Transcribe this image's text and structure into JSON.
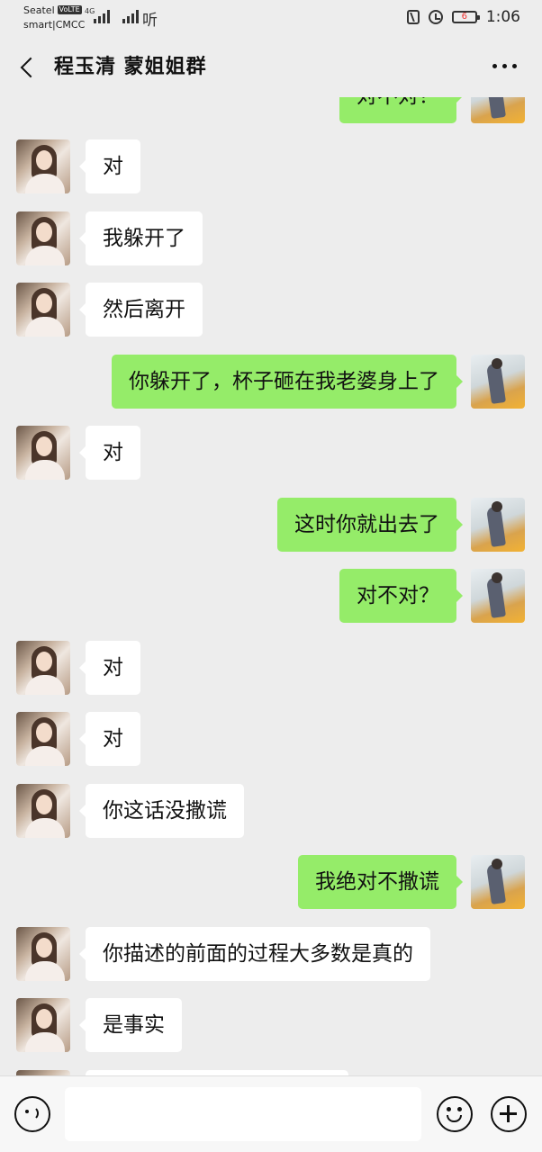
{
  "status_bar": {
    "carrier_1": "Seatel",
    "volte": "VoLTE",
    "carrier_2": "smart|CMCC",
    "network": "4G",
    "speed_indicator": "听",
    "battery_level": "6",
    "time": "1:06"
  },
  "nav": {
    "title": "程玉清 蒙姐姐群"
  },
  "messages": [
    {
      "side": "out",
      "text": "对不对？"
    },
    {
      "side": "in",
      "text": "对"
    },
    {
      "side": "in",
      "text": "我躲开了"
    },
    {
      "side": "in",
      "text": "然后离开"
    },
    {
      "side": "out",
      "text": "你躲开了，杯子砸在我老婆身上了"
    },
    {
      "side": "in",
      "text": "对"
    },
    {
      "side": "out",
      "text": "这时你就出去了"
    },
    {
      "side": "out",
      "text": "对不对？"
    },
    {
      "side": "in",
      "text": "对"
    },
    {
      "side": "in",
      "text": "对"
    },
    {
      "side": "in",
      "text": "你这话没撒谎"
    },
    {
      "side": "out",
      "text": "我绝对不撒谎"
    },
    {
      "side": "in",
      "text": "你描述的前面的过程大多数是真的"
    },
    {
      "side": "in",
      "text": "是事实"
    },
    {
      "side": "in",
      "text": ""
    }
  ],
  "input": {
    "value": ""
  },
  "icons": {
    "back": "back-arrow-icon",
    "more": "more-dots-icon",
    "voice": "voice-icon",
    "emoji": "emoji-icon",
    "plus": "plus-icon"
  },
  "colors": {
    "background": "#ededed",
    "outgoing_bubble": "#95ec69",
    "incoming_bubble": "#ffffff"
  }
}
